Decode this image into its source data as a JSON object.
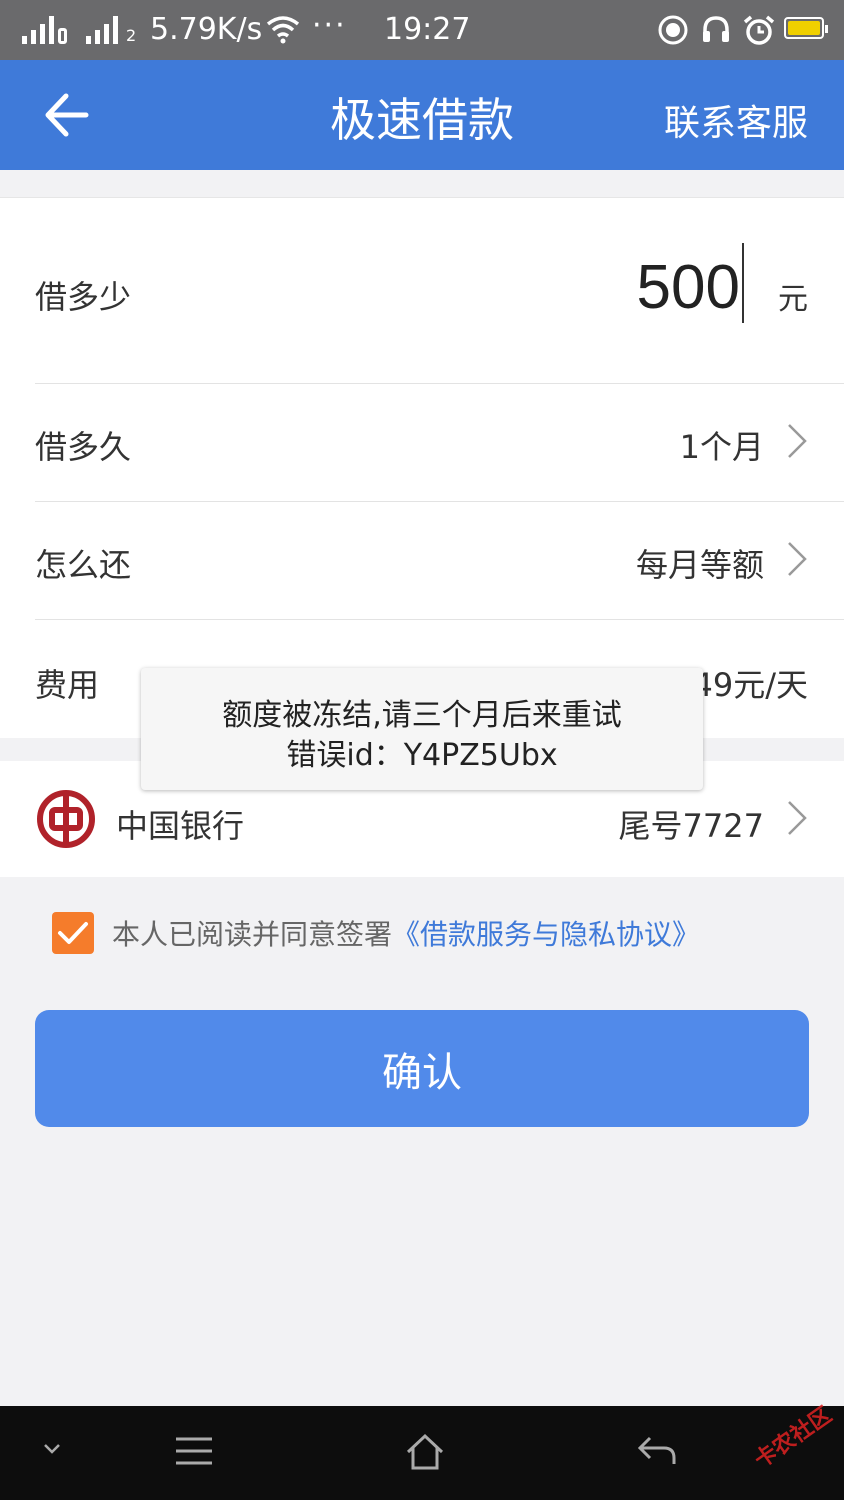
{
  "status_bar": {
    "net_speed": "5.79K/s",
    "more": "···",
    "time": "19:27",
    "sim_badge": "2"
  },
  "header": {
    "title": "极速借款",
    "service_label": "联系客服"
  },
  "form": {
    "amount_label": "借多少",
    "amount_value": "500",
    "amount_unit": "元",
    "term_label": "借多久",
    "term_value": "1个月",
    "repay_label": "怎么还",
    "repay_value": "每月等额",
    "fee_label": "费用",
    "fee_value": "49元/天"
  },
  "bank": {
    "name": "中国银行",
    "tail": "尾号7727"
  },
  "agreement": {
    "text": "本人已阅读并同意签署",
    "link": "《借款服务与隐私协议》",
    "checked": true
  },
  "confirm_label": "确认",
  "toast": {
    "line1": "额度被冻结,请三个月后来重试",
    "line2": "错误id：Y4PZ5Ubx"
  },
  "watermark": "卡农社区",
  "colors": {
    "header": "#3f7ad9",
    "button": "#518aea",
    "checkbox": "#f57c2b",
    "bank_logo": "#b0222a"
  }
}
